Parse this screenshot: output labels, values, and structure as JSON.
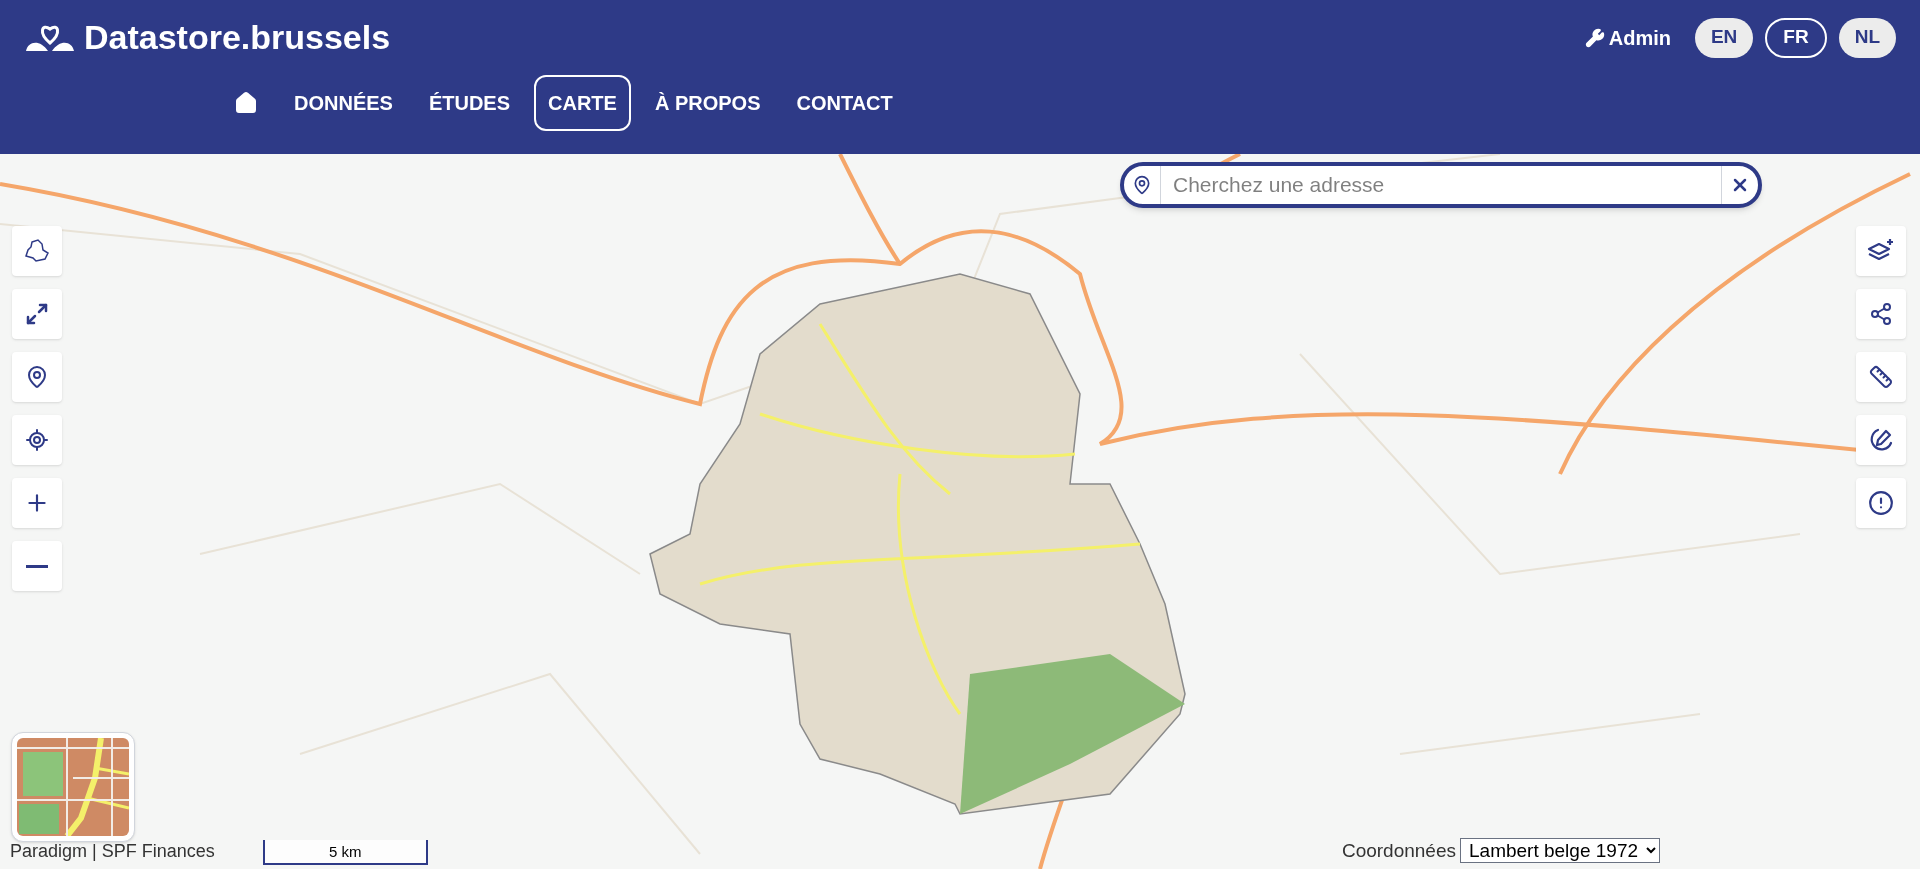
{
  "header": {
    "logo_text": "Datastore.brussels",
    "admin_link": "Admin",
    "languages": [
      {
        "label": "EN",
        "selected": false
      },
      {
        "label": "FR",
        "selected": true
      },
      {
        "label": "NL",
        "selected": false
      }
    ]
  },
  "nav": [
    {
      "kind": "home",
      "selected": false
    },
    {
      "kind": "link",
      "label": "DONNÉES",
      "selected": false
    },
    {
      "kind": "link",
      "label": "ÉTUDES",
      "selected": false
    },
    {
      "kind": "link",
      "label": "CARTE",
      "selected": true
    },
    {
      "kind": "link",
      "label": "À PROPOS",
      "selected": false
    },
    {
      "kind": "link",
      "label": "CONTACT",
      "selected": false
    }
  ],
  "search": {
    "placeholder": "Cherchez une adresse"
  },
  "map": {
    "attribution": "Paradigm | SPF Finances",
    "scale_bar": {
      "label": "5 km"
    },
    "coordinates": {
      "label": "Coordonnées",
      "value": "Lambert belge 1972"
    }
  }
}
